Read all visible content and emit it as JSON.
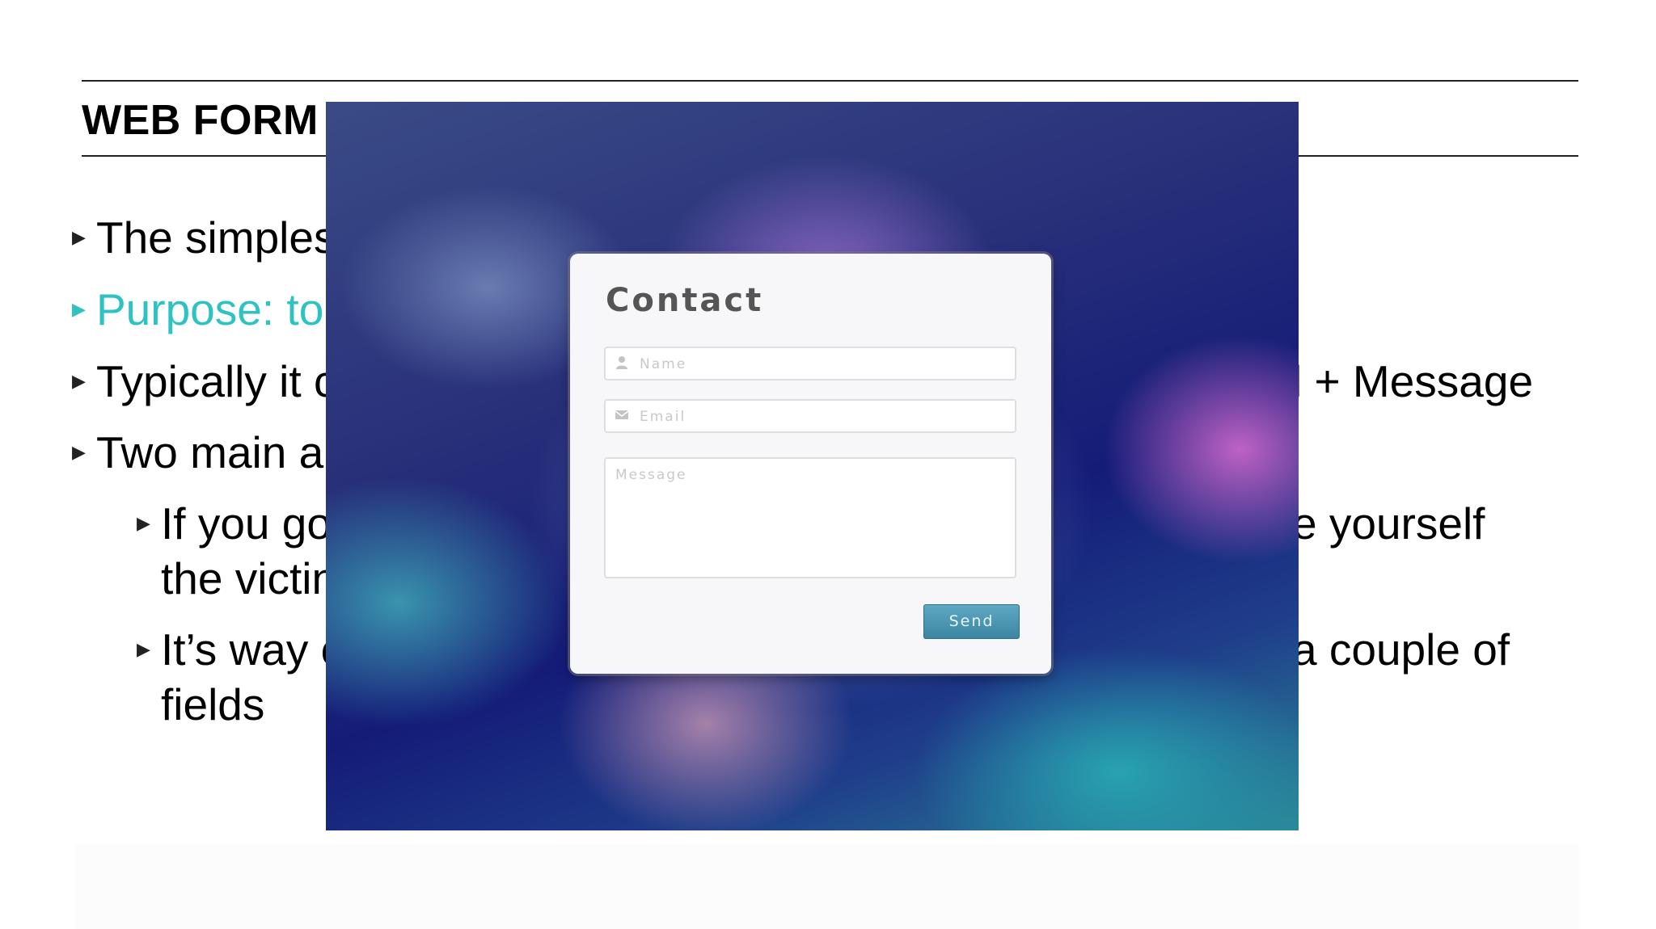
{
  "slide": {
    "title": "WEB FORM",
    "bullets": [
      {
        "text": "The simples",
        "level": 1
      },
      {
        "text": "Purpose: to",
        "level": 1,
        "accent": true
      },
      {
        "text": "Typically it c",
        "level": 1
      },
      {
        "text": "Two main a",
        "level": 1
      },
      {
        "text": "If you go",
        "level": 2
      },
      {
        "text": "the victin",
        "level": 2
      },
      {
        "text": "It’s way c",
        "level": 2
      },
      {
        "text": "fields",
        "level": 2
      }
    ],
    "right_fragments": {
      "line3": "l + Message",
      "line5": "e yourself",
      "line7": "a couple of"
    },
    "colors": {
      "accent": "#2ec2c2",
      "text": "#000000"
    }
  },
  "overlay": {
    "contact_form": {
      "title": "Contact",
      "name_placeholder": "Name",
      "email_placeholder": "Email",
      "message_placeholder": "Message",
      "send_label": "Send",
      "name_icon": "person-icon",
      "email_icon": "envelope-icon"
    },
    "colors": {
      "button": "#4a95b2",
      "background": "#1a2380"
    }
  }
}
